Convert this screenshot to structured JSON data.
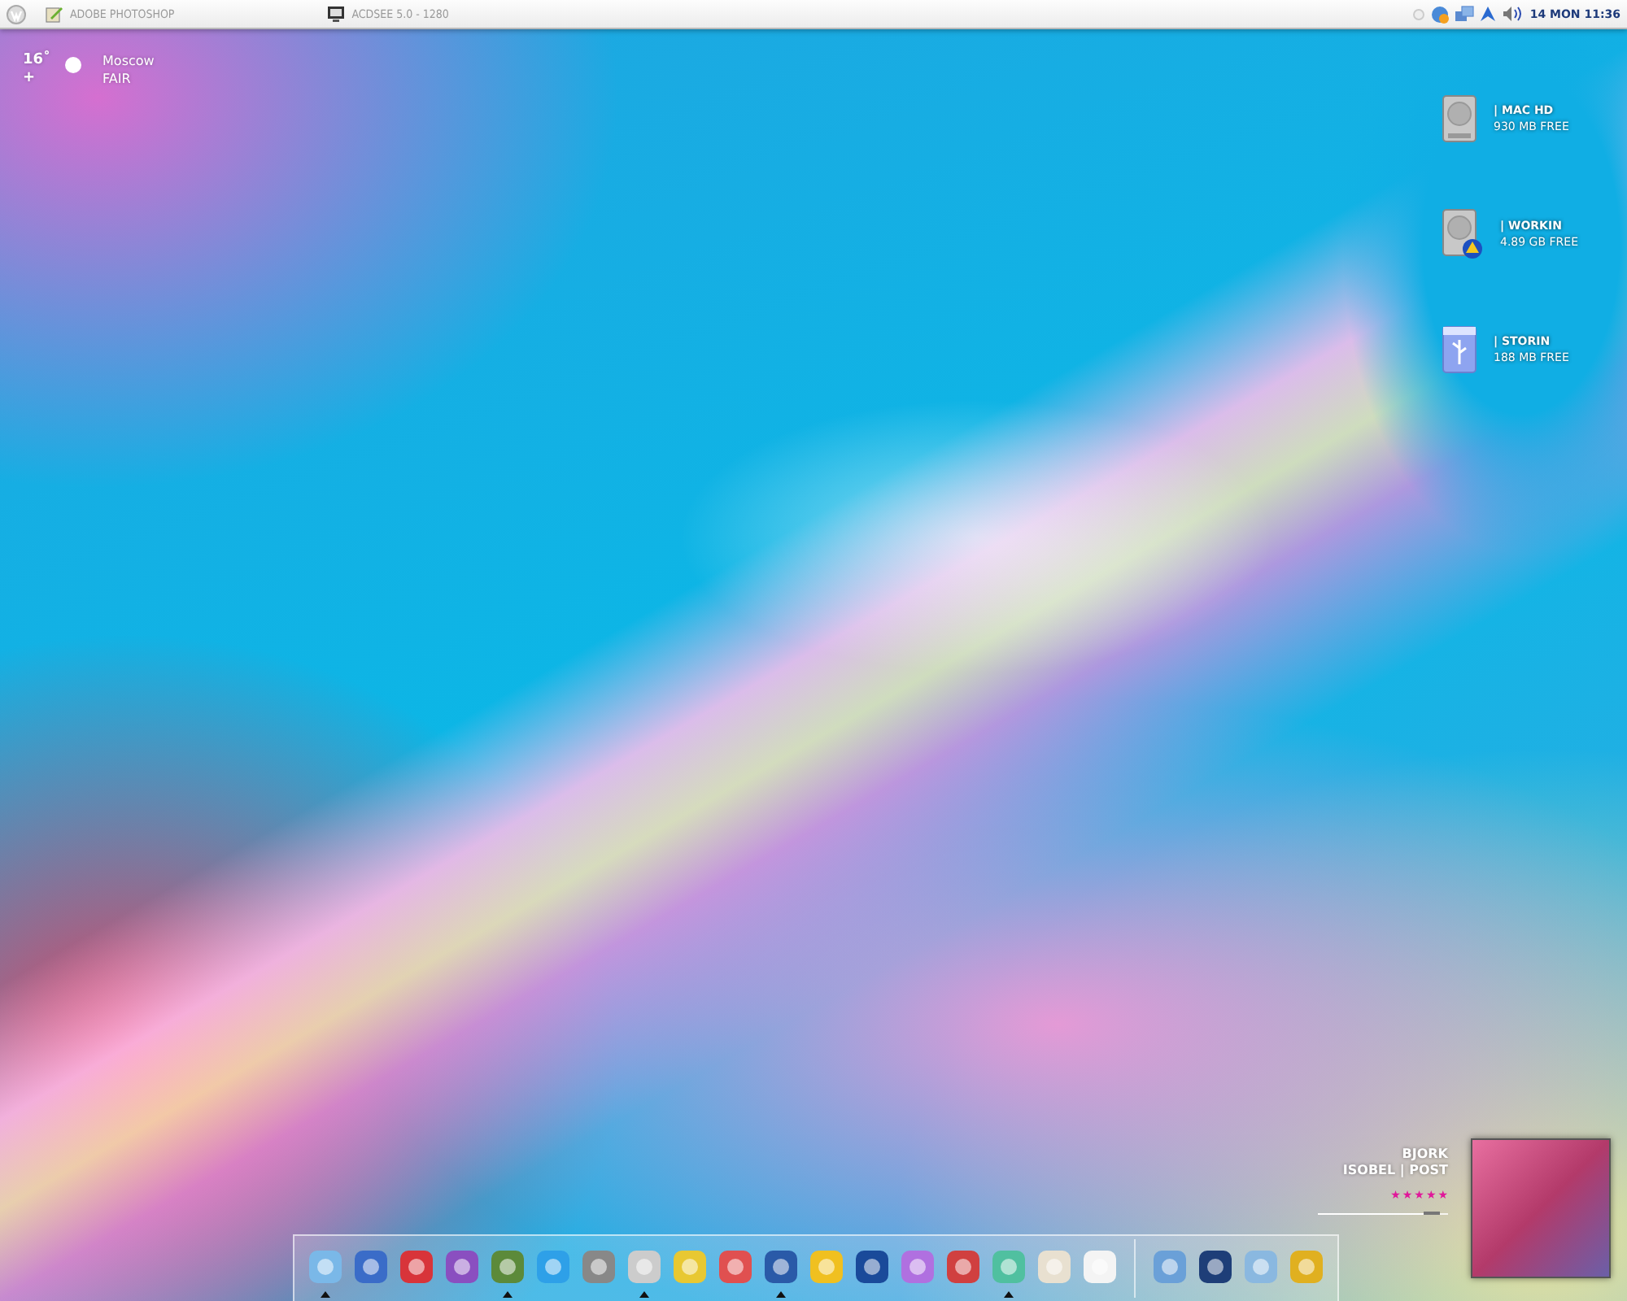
{
  "menubar": {
    "tasks": [
      {
        "label": "ADOBE PHOTOSHOP",
        "kind": "brush"
      },
      {
        "label": "ACDSEE 5.0 - 1280",
        "kind": "viewer"
      }
    ],
    "clock": "14 MON 11:36"
  },
  "weather": {
    "temperature": "16˚",
    "sign": "+",
    "city": "Moscow",
    "condition": "FAIR"
  },
  "drives": [
    {
      "name": "| MAC HD",
      "free": "930 MB FREE",
      "kind": "disk"
    },
    {
      "name": "| WORKIN",
      "free": "4.89 GB FREE",
      "kind": "shared-disk"
    },
    {
      "name": "| STORIN",
      "free": "188 MB FREE",
      "kind": "usb"
    }
  ],
  "now_playing": {
    "artist": "BJORK",
    "track": "ISOBEL | POST",
    "stars": 5,
    "level": 0.88
  },
  "dock": {
    "apps": [
      {
        "running": true
      },
      {
        "running": false
      },
      {
        "running": false
      },
      {
        "running": false
      },
      {
        "running": true
      },
      {
        "running": false
      },
      {
        "running": false
      },
      {
        "running": true
      },
      {
        "running": false
      },
      {
        "running": false
      },
      {
        "running": true
      },
      {
        "running": false
      },
      {
        "running": false
      },
      {
        "running": false
      },
      {
        "running": false
      },
      {
        "running": true
      },
      {
        "running": false
      },
      {
        "running": false
      }
    ],
    "utilities": [
      {
        "running": false
      },
      {
        "running": false
      },
      {
        "running": false
      },
      {
        "running": false
      }
    ]
  }
}
